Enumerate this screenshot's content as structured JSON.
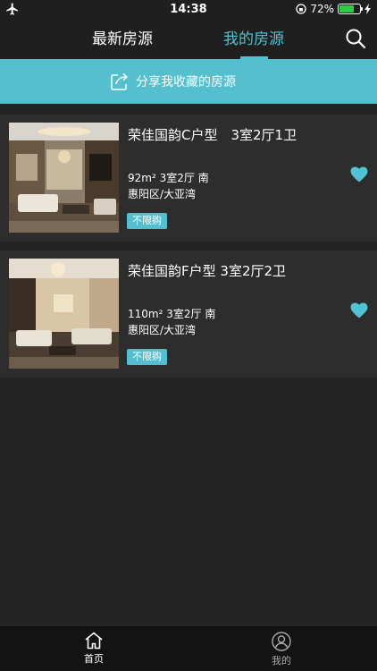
{
  "status_bar": {
    "time": "14:38",
    "battery_text": "72%",
    "battery_level": 0.72,
    "battery_color": "#2ccd45"
  },
  "top_nav": {
    "tabs": [
      {
        "label": "最新房源",
        "active": false
      },
      {
        "label": "我的房源",
        "active": true
      }
    ],
    "search_icon": "search-icon",
    "accent": "#4fc3d3"
  },
  "share_bar": {
    "label": "分享我收藏的房源",
    "icon": "share-icon",
    "color": "#54bfcf"
  },
  "listings": [
    {
      "title": "荣佳国韵C户型　3室2厅1卫",
      "area_number": "92",
      "area_unit": "m²",
      "spec": "3室2厅 南",
      "district": "惠阳区/大亚湾",
      "badge": "不限购",
      "favorited": true
    },
    {
      "title": "荣佳国韵F户型 3室2厅2卫",
      "area_number": "110",
      "area_unit": "m²",
      "spec": "3室2厅 南",
      "district": "惠阳区/大亚湾",
      "badge": "不限购",
      "favorited": true
    }
  ],
  "bottom_bar": {
    "items": [
      {
        "label": "首页",
        "icon": "home-icon",
        "active": true
      },
      {
        "label": "我的",
        "icon": "user-icon",
        "active": false
      }
    ]
  }
}
